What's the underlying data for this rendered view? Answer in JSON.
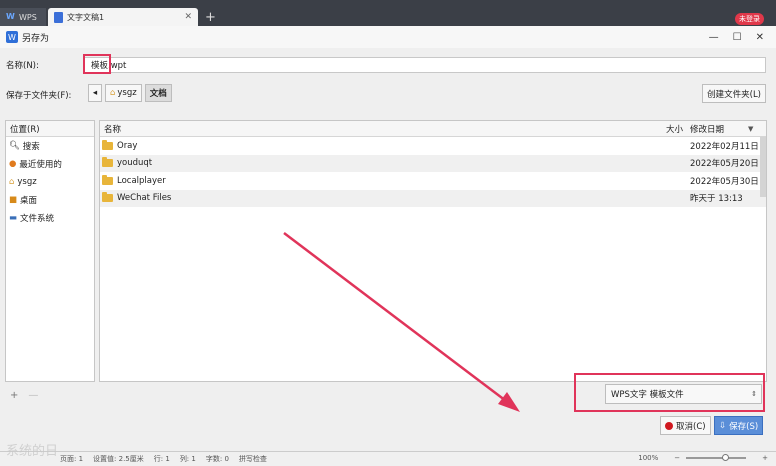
{
  "app_tabs": {
    "wps_label": "WPS",
    "doc_label": "文字文稿1",
    "login_badge": "未登录"
  },
  "dialog": {
    "title": "另存为",
    "name_label": "名称(N):",
    "name_value": "模板.wpt",
    "save_in_label": "保存于文件夹(F):",
    "path": [
      "ysgz",
      "文档"
    ],
    "new_folder": "创建文件夹(L)",
    "places_header": "位置(R)",
    "places": [
      "搜索",
      "最近使用的",
      "ysgz",
      "桌面",
      "文件系统"
    ],
    "columns": {
      "name": "名称",
      "size": "大小",
      "modified": "修改日期"
    },
    "files": [
      {
        "name": "Oray",
        "date": "2022年02月11日"
      },
      {
        "name": "youduqt",
        "date": "2022年05月20日"
      },
      {
        "name": "Localplayer",
        "date": "2022年05月30日"
      },
      {
        "name": "WeChat Files",
        "date": "昨天于 13:13"
      }
    ],
    "file_type": "WPS文字 模板文件",
    "cancel": "取消(C)",
    "save": "保存(S)"
  },
  "status": {
    "page": "页面: 1",
    "settings": "设置值: 2.5厘米",
    "row": "行: 1",
    "col": "列: 1",
    "words": "字数: 0",
    "spell": "拼写检查",
    "zoom": "100%"
  },
  "watermark": "系统的日",
  "accent_color": "#e0345a"
}
